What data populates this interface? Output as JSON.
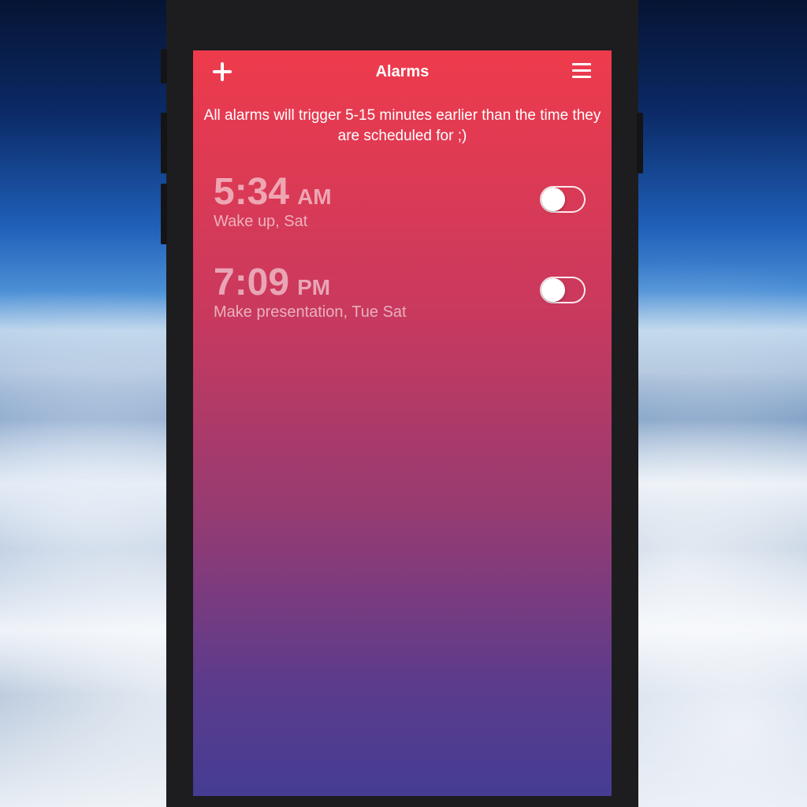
{
  "header": {
    "title": "Alarms",
    "add_icon": "plus-icon",
    "menu_icon": "hamburger-menu-icon"
  },
  "notice": "All alarms will trigger 5-15 minutes earlier than the time they are scheduled for ;)",
  "alarms": [
    {
      "time": "5:34",
      "period": "AM",
      "label": "Wake up, Sat",
      "enabled": false
    },
    {
      "time": "7:09",
      "period": "PM",
      "label": "Make presentation, Tue Sat",
      "enabled": false
    }
  ],
  "colors": {
    "gradient_top": "#ee3b4c",
    "gradient_bottom": "#453d93",
    "phone_frame": "#1d1d1f"
  }
}
